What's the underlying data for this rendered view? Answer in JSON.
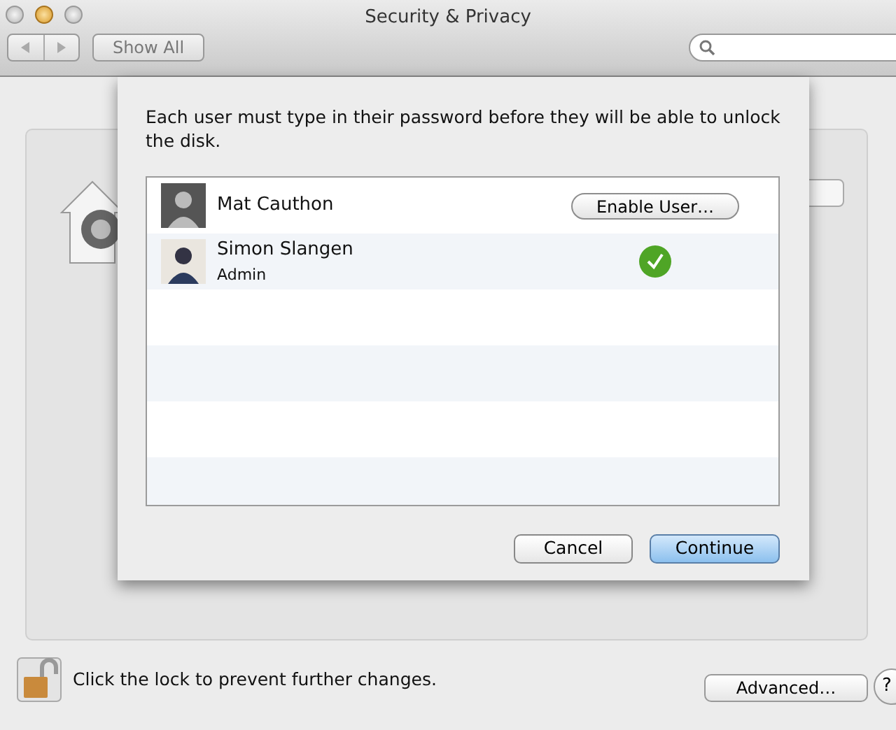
{
  "window": {
    "title": "Security & Privacy"
  },
  "toolbar": {
    "show_all": "Show All"
  },
  "sheet": {
    "message": "Each user must type in their password before they will be able to unlock the disk.",
    "users": [
      {
        "name": "Mat Cauthon",
        "kind": "disabled",
        "button": "Enable User…"
      },
      {
        "name": "Simon Slangen",
        "role": "Admin",
        "kind": "enabled"
      }
    ],
    "buttons": [
      {
        "label": "Cancel",
        "default": false
      },
      {
        "label": "Continue",
        "default": true
      }
    ]
  },
  "footer": {
    "lock_text": "Click the lock to prevent further changes.",
    "locked": false,
    "advanced": "Advanced…",
    "help": "?"
  }
}
